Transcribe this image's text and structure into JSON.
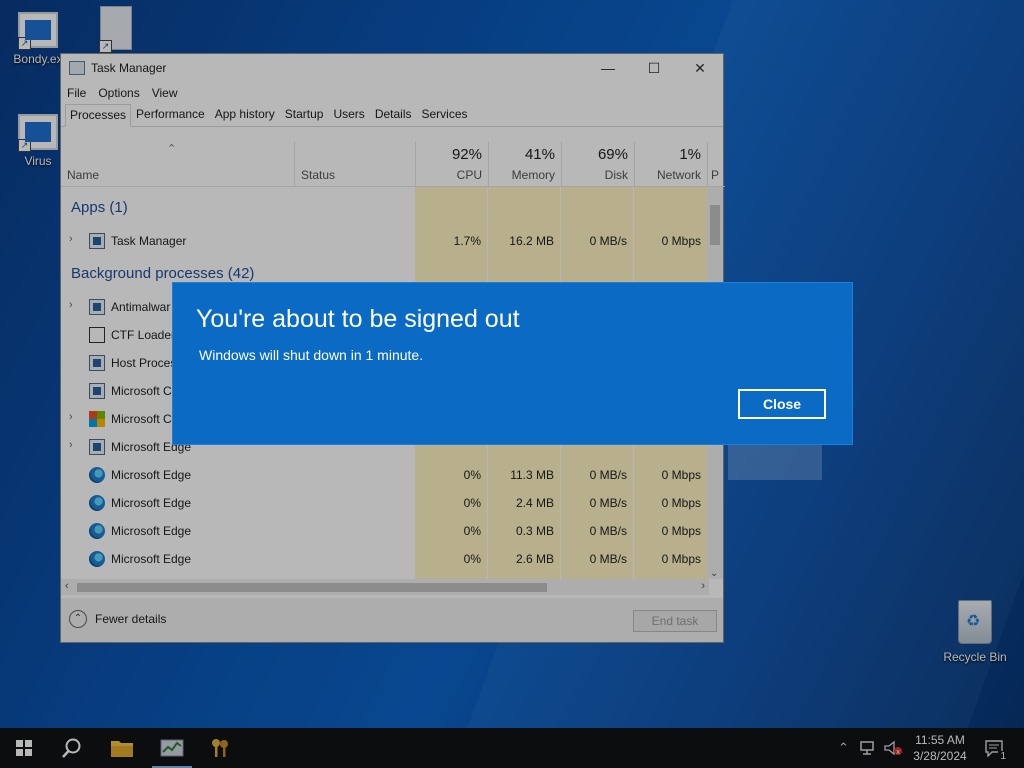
{
  "desktop": {
    "icons": [
      {
        "label": "Bondy.ex"
      },
      {
        "label": ""
      },
      {
        "label": "Virus"
      }
    ],
    "recycle_bin": "Recycle Bin"
  },
  "task_manager": {
    "title": "Task Manager",
    "menu": [
      "File",
      "Options",
      "View"
    ],
    "tabs": [
      "Processes",
      "Performance",
      "App history",
      "Startup",
      "Users",
      "Details",
      "Services"
    ],
    "active_tab": "Processes",
    "columns": {
      "name": "Name",
      "status": "Status",
      "cpu": {
        "pct": "92%",
        "label": "CPU"
      },
      "memory": {
        "pct": "41%",
        "label": "Memory"
      },
      "disk": {
        "pct": "69%",
        "label": "Disk"
      },
      "network": {
        "pct": "1%",
        "label": "Network"
      },
      "power": "P"
    },
    "groups": {
      "apps": "Apps (1)",
      "background": "Background processes (42)"
    },
    "rows": [
      {
        "name": "Task Manager",
        "cpu": "1.7%",
        "memory": "16.2 MB",
        "disk": "0 MB/s",
        "network": "0 Mbps"
      },
      {
        "name": "Antimalwar",
        "cpu": "",
        "memory": "",
        "disk": "",
        "network": ""
      },
      {
        "name": "CTF Loader",
        "cpu": "",
        "memory": "",
        "disk": "",
        "network": ""
      },
      {
        "name": "Host Proces",
        "cpu": "",
        "memory": "",
        "disk": "",
        "network": ""
      },
      {
        "name": "Microsoft C",
        "cpu": "",
        "memory": "",
        "disk": "",
        "network": ""
      },
      {
        "name": "Microsoft C",
        "cpu": "",
        "memory": "",
        "disk": "",
        "network": ""
      },
      {
        "name": "Microsoft Edge",
        "cpu": "",
        "memory": "",
        "disk": "",
        "network": ""
      },
      {
        "name": "Microsoft Edge",
        "cpu": "0%",
        "memory": "11.3 MB",
        "disk": "0 MB/s",
        "network": "0 Mbps"
      },
      {
        "name": "Microsoft Edge",
        "cpu": "0%",
        "memory": "2.4 MB",
        "disk": "0 MB/s",
        "network": "0 Mbps"
      },
      {
        "name": "Microsoft Edge",
        "cpu": "0%",
        "memory": "0.3 MB",
        "disk": "0 MB/s",
        "network": "0 Mbps"
      },
      {
        "name": "Microsoft Edge",
        "cpu": "0%",
        "memory": "2.6 MB",
        "disk": "0 MB/s",
        "network": "0 Mbps"
      }
    ],
    "fewer_details": "Fewer details",
    "end_task": "End task"
  },
  "dialog": {
    "title": "You're about to be signed out",
    "message": "Windows will shut down in 1 minute.",
    "close_label": "Close"
  },
  "taskbar": {
    "time": "11:55 AM",
    "date": "3/28/2024",
    "notification_count": "1"
  }
}
